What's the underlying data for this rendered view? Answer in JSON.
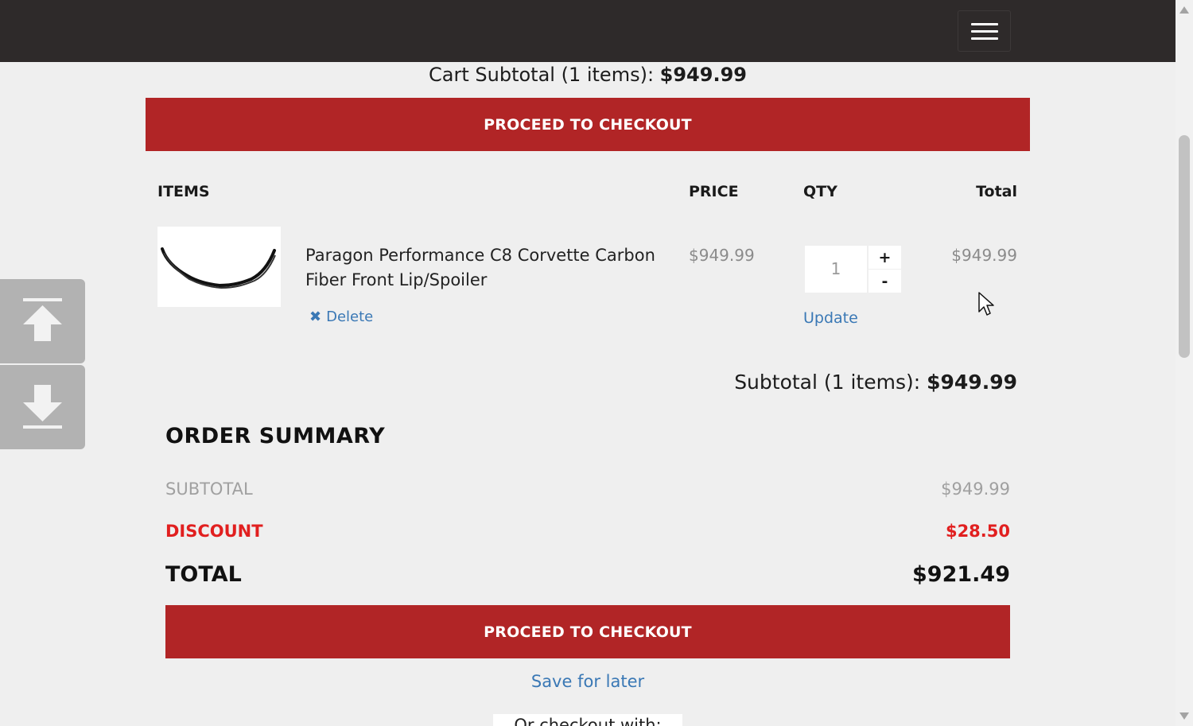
{
  "header": {
    "menu_icon": "hamburger-menu-icon"
  },
  "cart": {
    "subtotal_label": "Cart Subtotal (1 items): ",
    "subtotal_value": "$949.99",
    "checkout_label": "PROCEED TO CHECKOUT"
  },
  "table": {
    "headers": {
      "items": "ITEMS",
      "price": "PRICE",
      "qty": "QTY",
      "total": "Total"
    },
    "rows": [
      {
        "name": "Paragon Performance C8 Corvette Carbon Fiber Front Lip/Spoiler",
        "price": "$949.99",
        "qty": "1",
        "total": "$949.99",
        "delete_label": "Delete",
        "update_label": "Update",
        "plus_label": "+",
        "minus_label": "-"
      }
    ],
    "subtotal_label": "Subtotal (1 items): ",
    "subtotal_value": "$949.99"
  },
  "summary": {
    "title": "ORDER SUMMARY",
    "subtotal_label": "SUBTOTAL",
    "subtotal_value": "$949.99",
    "discount_label": "DISCOUNT",
    "discount_value": "$28.50",
    "total_label": "TOTAL",
    "total_value": "$921.49",
    "checkout_label": "PROCEED TO CHECKOUT",
    "save_later": "Save for later",
    "or_checkout": "Or checkout with:"
  },
  "colors": {
    "topbar": "#2e2a2a",
    "accent_red": "#b12526",
    "discount_red": "#e11f1f",
    "link_blue": "#3a78b5"
  },
  "icons": {
    "scroll_up": "arrow-up-icon",
    "scroll_down": "arrow-down-icon",
    "delete": "close-icon",
    "cursor": "mouse-pointer-icon"
  }
}
